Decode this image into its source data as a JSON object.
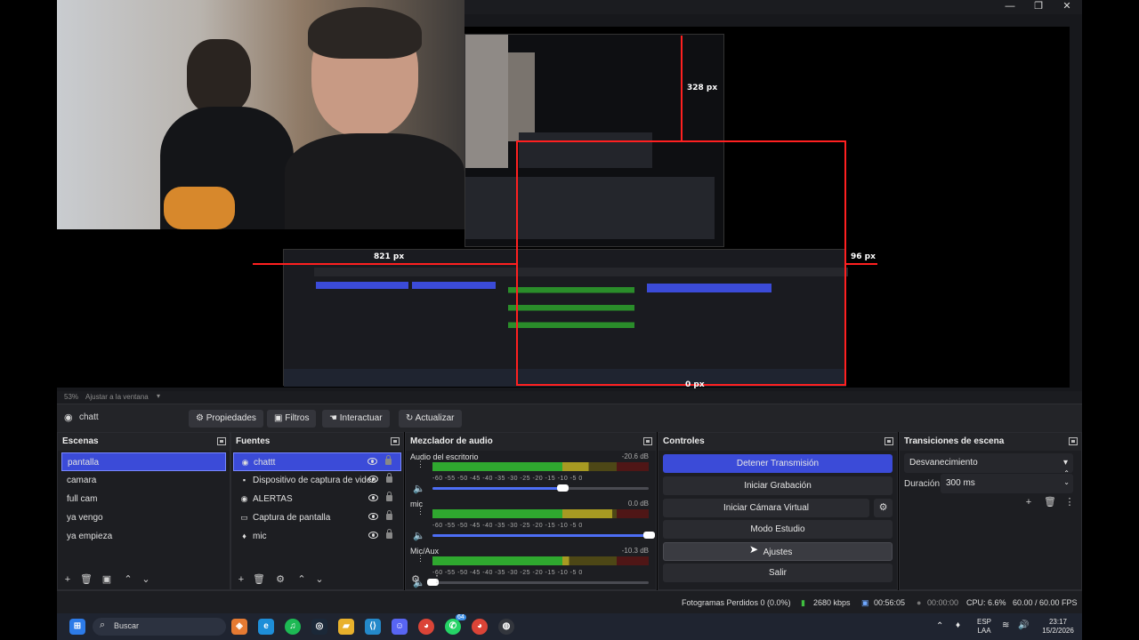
{
  "window": {
    "minimize_glyph": "—",
    "maximize_glyph": "❐",
    "close_glyph": "✕"
  },
  "preview": {
    "labels": {
      "top": "328 px",
      "left": "821 px",
      "right": "96 px",
      "bottom": "0 px"
    },
    "zoom": "53%",
    "zoom_option": "Ajustar a la ventana"
  },
  "scene_bar": {
    "current_scene": "chatt",
    "buttons": {
      "properties": "Propiedades",
      "filters": "Filtros",
      "interact": "Interactuar",
      "refresh": "Actualizar"
    }
  },
  "scenes": {
    "title": "Escenas",
    "items": [
      {
        "label": "pantalla",
        "selected": true
      },
      {
        "label": "camara"
      },
      {
        "label": "full cam"
      },
      {
        "label": "ya vengo"
      },
      {
        "label": "ya empieza"
      }
    ]
  },
  "sources": {
    "title": "Fuentes",
    "items": [
      {
        "label": "chattt",
        "icon": "browser-icon",
        "selected": true
      },
      {
        "label": "Dispositivo de captura de video",
        "icon": "camera-icon"
      },
      {
        "label": "ALERTAS",
        "icon": "browser-icon"
      },
      {
        "label": "Captura de pantalla",
        "icon": "monitor-icon"
      },
      {
        "label": "mic",
        "icon": "microphone-icon"
      }
    ]
  },
  "mixer": {
    "title": "Mezclador de audio",
    "ticks": "-60 -55 -50 -45 -40 -35 -30 -25 -20 -15 -10 -5 0",
    "channels": [
      {
        "name": "Audio del escritorio",
        "db": "-20.6 dB",
        "level": 0.72,
        "volume": 0.6
      },
      {
        "name": "mic",
        "db": "0.0 dB",
        "level": 0.83,
        "volume": 1.0
      },
      {
        "name": "Mic/Aux",
        "db": "-10.3 dB",
        "level": 0.63,
        "volume": 0.0
      }
    ]
  },
  "controls": {
    "title": "Controles",
    "buttons": {
      "stop_stream": "Detener Transmisión",
      "start_recording": "Iniciar Grabación",
      "start_virtual_cam": "Iniciar Cámara Virtual",
      "studio_mode": "Modo Estudio",
      "settings": "Ajustes",
      "exit": "Salir"
    }
  },
  "transitions": {
    "title": "Transiciones de escena",
    "selected": "Desvanecimiento",
    "duration_label": "Duración",
    "duration_value": "300 ms"
  },
  "status": {
    "dropped_frames": "Fotogramas Perdidos 0 (0.0%)",
    "bitrate": "2680 kbps",
    "stream_time": "00:56:05",
    "record_time": "00:00:00",
    "cpu": "CPU: 6.6%",
    "fps": "60.00 / 60.00 FPS"
  },
  "taskbar": {
    "search_placeholder": "Buscar",
    "language": "ESP",
    "layout": "LAA",
    "time": "23:17",
    "date": "15/2/2026",
    "whatsapp_badge": "64"
  },
  "colors": {
    "accent": "#3b4bd8",
    "red_guide": "#ff2020",
    "meter_green": "#2fa82f",
    "meter_yellow": "#a79a22",
    "meter_red": "#b02a2a"
  }
}
